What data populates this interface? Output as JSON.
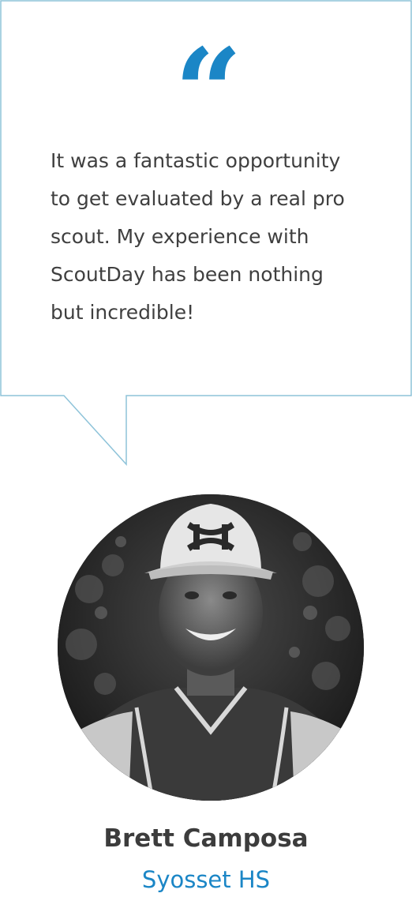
{
  "testimonial": {
    "quote_icon": "quote-open-icon",
    "quote_lines": "It was a fantastic opportunity\nto get evaluated by a real pro\nscout.  My experience with\nScoutDay has been nothing\nbut incredible!",
    "author_name": "Brett Camposa",
    "author_school": "Syosset HS"
  },
  "colors": {
    "accent": "#1b86c6",
    "bubble_border": "#8ec3d9",
    "text": "#3f3f3f"
  }
}
